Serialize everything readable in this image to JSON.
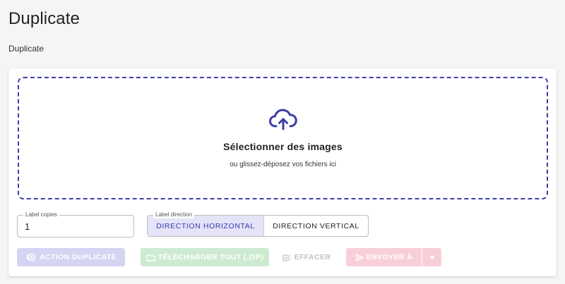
{
  "page": {
    "title": "Duplicate",
    "subtitle": "Duplicate"
  },
  "dropzone": {
    "icon": "cloud-upload-icon",
    "title": "Sélectionner des images",
    "subtitle": "ou glissez-déposez vos fichiers ici",
    "accent_color": "#3d3da8"
  },
  "label_copies": {
    "label": "Label copies",
    "value": "1"
  },
  "label_direction": {
    "label": "Label direction",
    "options": [
      "Direction horizontal",
      "Direction vertical"
    ],
    "selected": "Direction horizontal"
  },
  "actions": {
    "duplicate": {
      "label": "Action duplicate",
      "icon": "duplicate-icon",
      "color": "#d4d4f3"
    },
    "download_all": {
      "label": "Télécharger tout (.zip)",
      "icon": "folder-icon",
      "color": "#cdebd1"
    },
    "clear": {
      "label": "Effacer",
      "icon": "clear-icon",
      "color": "#c2c2c2"
    },
    "send_to": {
      "label": "Envoyer à",
      "icon": "send-icon",
      "color": "#f8cfd8"
    },
    "send_more": {
      "icon": "caret-down-icon"
    }
  }
}
